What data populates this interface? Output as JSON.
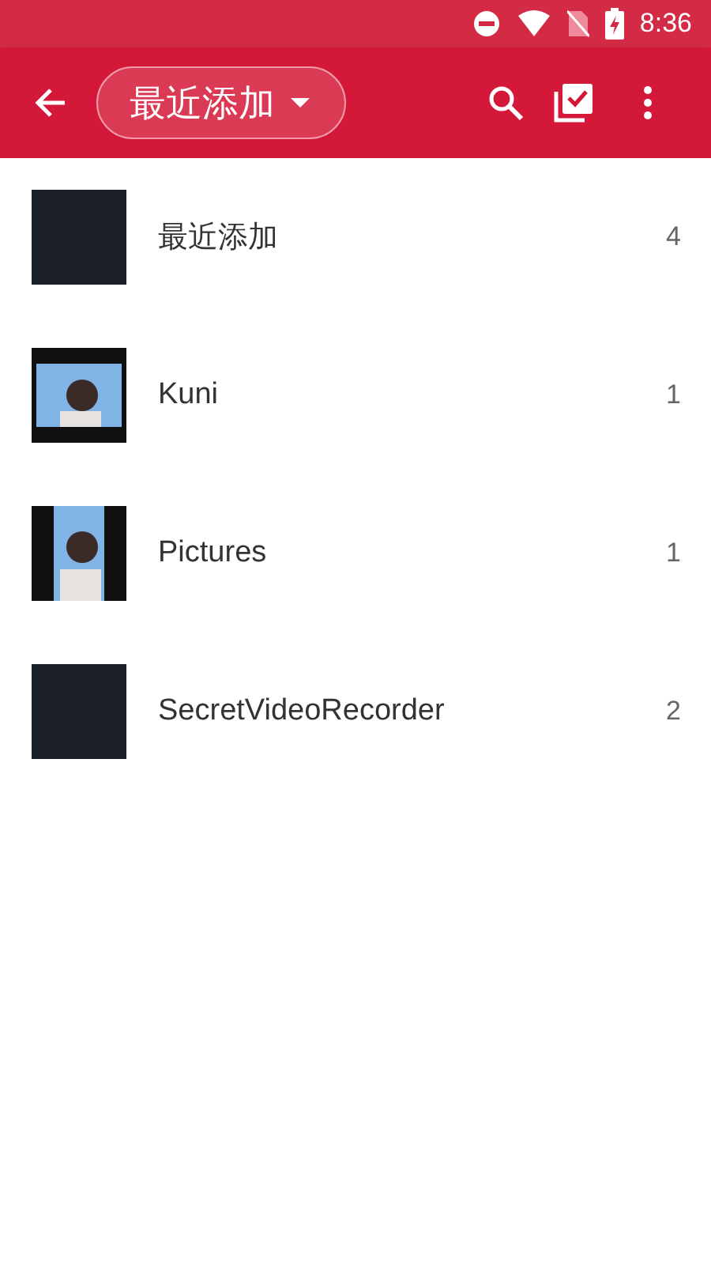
{
  "status_bar": {
    "time": "8:36"
  },
  "toolbar": {
    "album_selector": "最近添加"
  },
  "album_menu": [
    {
      "name": "最近添加",
      "count": "4",
      "kind": "blank"
    },
    {
      "name": "Kuni",
      "count": "1",
      "kind": "picture"
    },
    {
      "name": "Pictures",
      "count": "1",
      "kind": "picture"
    },
    {
      "name": "SecretVideoRecorder",
      "count": "2",
      "kind": "blank"
    }
  ]
}
